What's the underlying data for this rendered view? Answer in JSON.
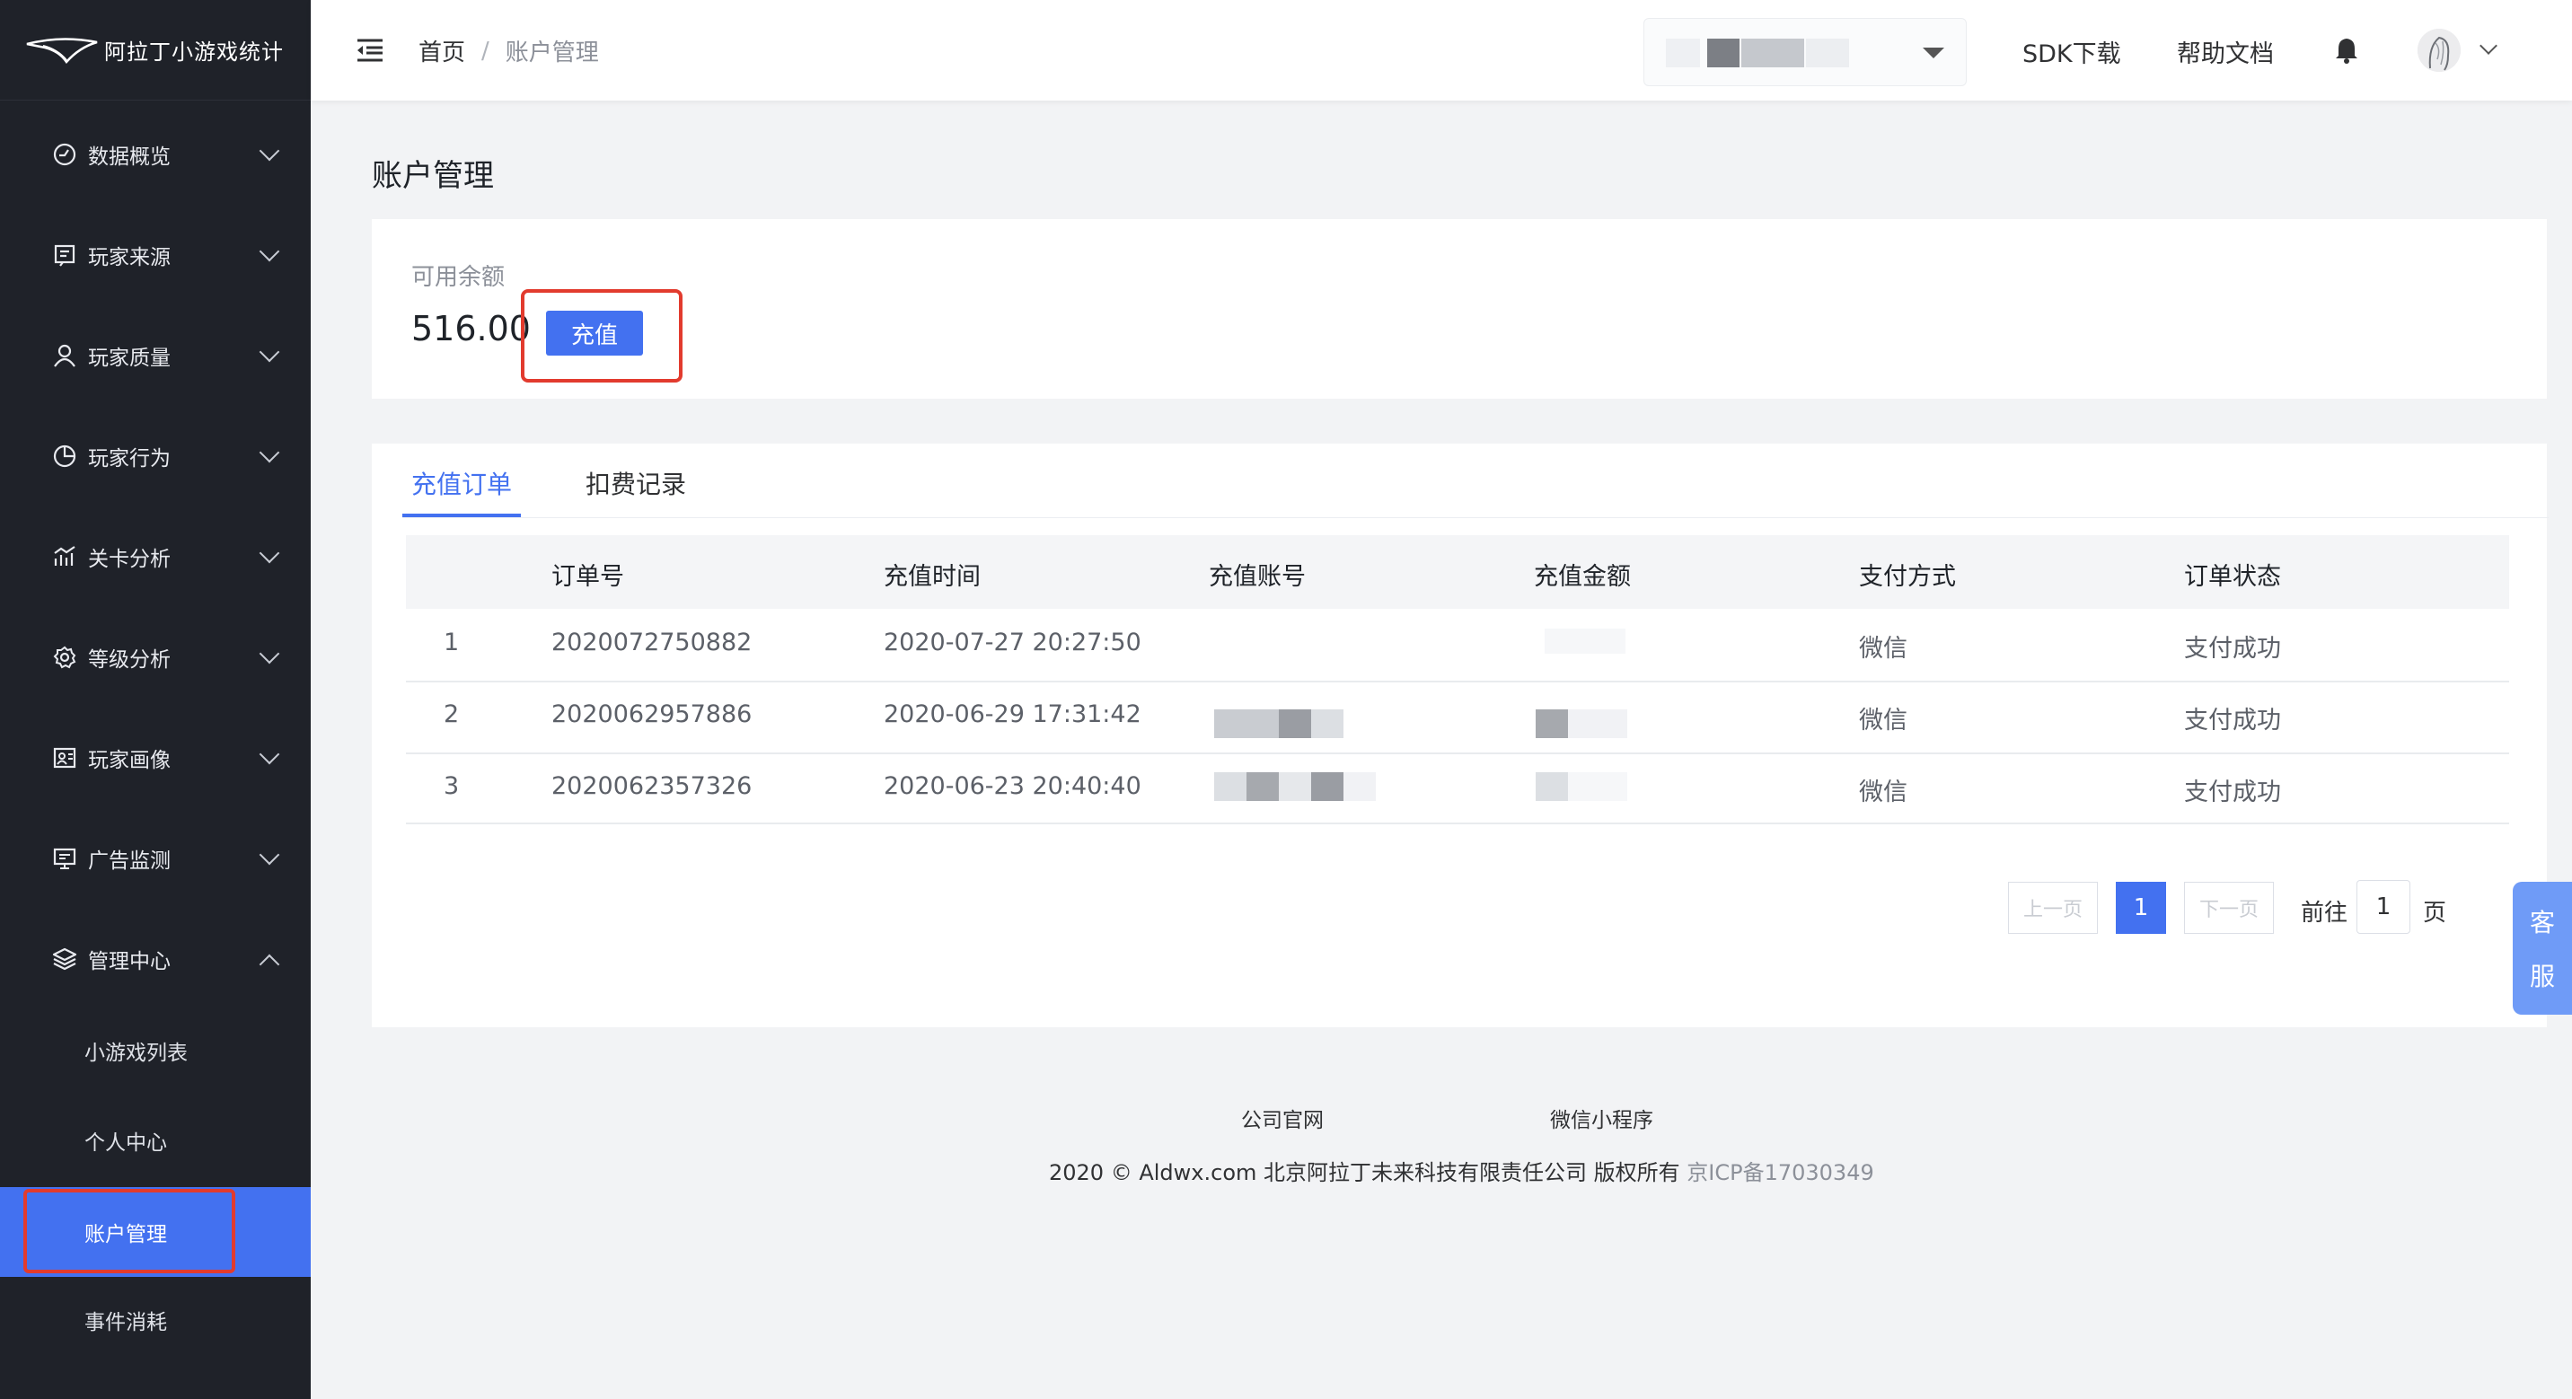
{
  "app": {
    "name": "阿拉丁小游戏统计"
  },
  "sidebar": {
    "items": [
      {
        "label": "数据概览",
        "icon": "dashboard-icon"
      },
      {
        "label": "玩家来源",
        "icon": "source-icon"
      },
      {
        "label": "玩家质量",
        "icon": "user-icon"
      },
      {
        "label": "玩家行为",
        "icon": "pie-icon"
      },
      {
        "label": "关卡分析",
        "icon": "chart-icon"
      },
      {
        "label": "等级分析",
        "icon": "gear-icon"
      },
      {
        "label": "玩家画像",
        "icon": "portrait-icon"
      },
      {
        "label": "广告监测",
        "icon": "monitor-icon"
      },
      {
        "label": "管理中心",
        "icon": "layers-icon"
      }
    ],
    "sub_items": [
      "小游戏列表",
      "个人中心",
      "账户管理",
      "事件消耗"
    ],
    "active_sub": "账户管理"
  },
  "header": {
    "breadcrumb": {
      "home": "首页",
      "separator": "/",
      "current": "账户管理"
    },
    "sdk_link": "SDK下载",
    "docs_link": "帮助文档"
  },
  "page": {
    "title": "账户管理"
  },
  "balance": {
    "label": "可用余额",
    "value": "516.00",
    "recharge_label": "充值"
  },
  "tabs": [
    "充值订单",
    "扣费记录"
  ],
  "table": {
    "headers": [
      "订单号",
      "充值时间",
      "充值账号",
      "充值金额",
      "支付方式",
      "订单状态"
    ],
    "rows": [
      {
        "index": "1",
        "order_no": "2020072750882",
        "time": "2020-07-27 20:27:50",
        "payment": "微信",
        "status": "支付成功"
      },
      {
        "index": "2",
        "order_no": "2020062957886",
        "time": "2020-06-29 17:31:42",
        "payment": "微信",
        "status": "支付成功"
      },
      {
        "index": "3",
        "order_no": "2020062357326",
        "time": "2020-06-23 20:40:40",
        "payment": "微信",
        "status": "支付成功"
      }
    ]
  },
  "pagination": {
    "prev": "上一页",
    "next": "下一页",
    "current": "1",
    "goto_label": "前往",
    "goto_value": "1",
    "page_suffix": "页"
  },
  "footer": {
    "links": [
      "公司官网",
      "微信小程序"
    ],
    "copyright": "2020 © Aldwx.com 北京阿拉丁未来科技有限责任公司 版权所有",
    "icp": "京ICP备17030349"
  },
  "service": {
    "char1": "客",
    "char2": "服"
  },
  "colors": {
    "accent": "#4371f0",
    "sidebar_bg": "#1f2229",
    "highlight_border": "#e23b2e"
  }
}
